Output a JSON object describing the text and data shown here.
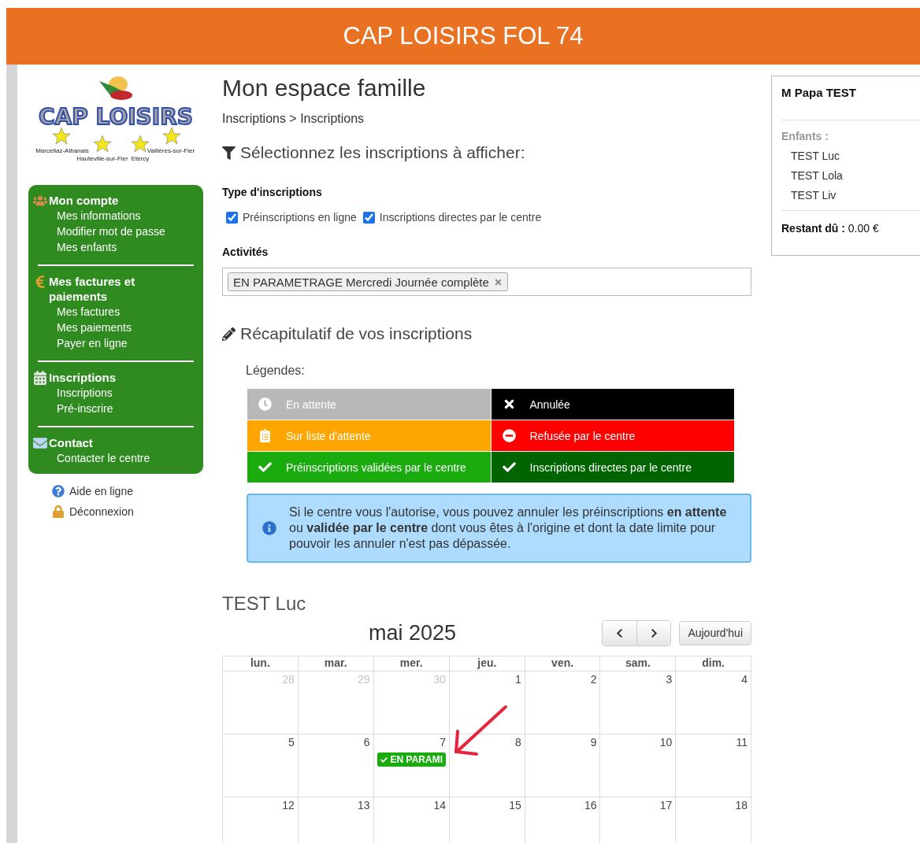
{
  "header": {
    "title": "CAP LOISIRS FOL 74"
  },
  "logo": {
    "wordmark": "CAP LOISIRS",
    "places": [
      "Marcellaz-Albanais",
      "Hauteville-sur-Fier",
      "Etercy",
      "Vallières-sur-Fier"
    ]
  },
  "sidebar": {
    "sections": [
      {
        "title": "Mon compte",
        "links": [
          "Mes informations",
          "Modifier mot de passe",
          "Mes enfants"
        ]
      },
      {
        "title": "Mes factures et paiements",
        "links": [
          "Mes factures",
          "Mes paiements",
          "Payer en ligne"
        ]
      },
      {
        "title": "Inscriptions",
        "links": [
          "Inscriptions",
          "Pré-inscrire"
        ]
      },
      {
        "title": "Contact",
        "links": [
          "Contacter le centre"
        ]
      }
    ],
    "extra_links": [
      "Aide en ligne",
      "Déconnexion"
    ]
  },
  "main": {
    "title": "Mon espace famille",
    "breadcrumb": "Inscriptions > Inscriptions",
    "filter_heading": "Sélectionnez les inscriptions à afficher:",
    "type_label": "Type d'inscriptions",
    "checkboxes": [
      {
        "label": "Préinscriptions en ligne",
        "checked": true
      },
      {
        "label": "Inscriptions directes par le centre",
        "checked": true
      }
    ],
    "activities_label": "Activités",
    "activities_tags": [
      {
        "label": "EN PARAMETRAGE Mercredi Journée complète"
      }
    ],
    "recap_heading": "Récapitulatif de vos inscriptions",
    "legend_label": "Légendes:",
    "legend": [
      {
        "label": "En attente",
        "color": "#b8b8b8"
      },
      {
        "label": "Annulée",
        "color": "#000000"
      },
      {
        "label": "Sur liste d'attente",
        "color": "#ffa500"
      },
      {
        "label": "Refusée par le centre",
        "color": "#ff0000"
      },
      {
        "label": "Préinscriptions validées par le centre",
        "color": "#1aab0f"
      },
      {
        "label": "Inscriptions directes par le centre",
        "color": "#006400"
      }
    ],
    "info_text": "Si le centre vous l'autorise, vous pouvez annuler les préinscriptions **en attente** ou **validée par le centre** dont vous êtes à l'origine et dont la date limite pour pouvoir les annuler n'est pas dépassée.",
    "child_name": "TEST Luc",
    "calendar": {
      "month": "mai 2025",
      "today_button": "Aujourd'hui",
      "weekdays": [
        "lun.",
        "mar.",
        "mer.",
        "jeu.",
        "ven.",
        "sam.",
        "dim."
      ],
      "weeks": [
        [
          {
            "day": "28",
            "other_month": true
          },
          {
            "day": "29",
            "other_month": true
          },
          {
            "day": "30",
            "other_month": true
          },
          {
            "day": "1",
            "other_month": false
          },
          {
            "day": "2",
            "other_month": false
          },
          {
            "day": "3",
            "other_month": false
          },
          {
            "day": "4",
            "other_month": false
          }
        ],
        [
          {
            "day": "5",
            "other_month": false
          },
          {
            "day": "6",
            "other_month": false
          },
          {
            "day": "7",
            "other_month": false,
            "events": [
              {
                "label": "EN PARAMI",
                "color": "#1aab0f"
              }
            ]
          },
          {
            "day": "8",
            "other_month": false
          },
          {
            "day": "9",
            "other_month": false
          },
          {
            "day": "10",
            "other_month": false
          },
          {
            "day": "11",
            "other_month": false
          }
        ],
        [
          {
            "day": "12",
            "other_month": false
          },
          {
            "day": "13",
            "other_month": false
          },
          {
            "day": "14",
            "other_month": false
          },
          {
            "day": "15",
            "other_month": false
          },
          {
            "day": "16",
            "other_month": false
          },
          {
            "day": "17",
            "other_month": false
          },
          {
            "day": "18",
            "other_month": false
          }
        ]
      ]
    }
  },
  "account": {
    "name": "M Papa TEST",
    "children_label": "Enfants :",
    "children": [
      "TEST Luc",
      "TEST Lola",
      "TEST Liv"
    ],
    "balance": "**Restant dû :** 0.00 €"
  }
}
